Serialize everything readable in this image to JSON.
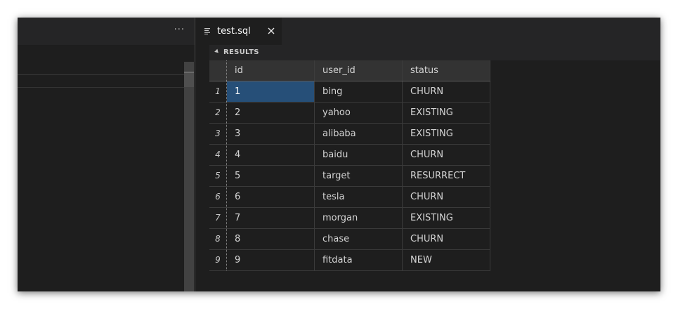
{
  "left_pane": {
    "more_label": "···"
  },
  "editor": {
    "tab": {
      "label": "test.sql",
      "close_glyph": "✕"
    }
  },
  "results": {
    "title": "RESULTS",
    "columns": [
      "id",
      "user_id",
      "status"
    ],
    "rows": [
      {
        "num": "1",
        "id": "1",
        "user_id": "bing",
        "status": "CHURN"
      },
      {
        "num": "2",
        "id": "2",
        "user_id": "yahoo",
        "status": "EXISTING"
      },
      {
        "num": "3",
        "id": "3",
        "user_id": "alibaba",
        "status": "EXISTING"
      },
      {
        "num": "4",
        "id": "4",
        "user_id": "baidu",
        "status": "CHURN"
      },
      {
        "num": "5",
        "id": "5",
        "user_id": "target",
        "status": "RESURRECT"
      },
      {
        "num": "6",
        "id": "6",
        "user_id": "tesla",
        "status": "CHURN"
      },
      {
        "num": "7",
        "id": "7",
        "user_id": "morgan",
        "status": "EXISTING"
      },
      {
        "num": "8",
        "id": "8",
        "user_id": "chase",
        "status": "CHURN"
      },
      {
        "num": "9",
        "id": "9",
        "user_id": "fitdata",
        "status": "NEW"
      }
    ]
  },
  "theme": {
    "background": "#1e1e1e",
    "header_background": "#252526",
    "selection": "#264f78",
    "text": "#d4d4d4"
  },
  "icons": {
    "more": "more-horizontal-icon",
    "file": "lines-file-icon",
    "close": "close-icon",
    "collapse": "triangle-down-icon"
  }
}
